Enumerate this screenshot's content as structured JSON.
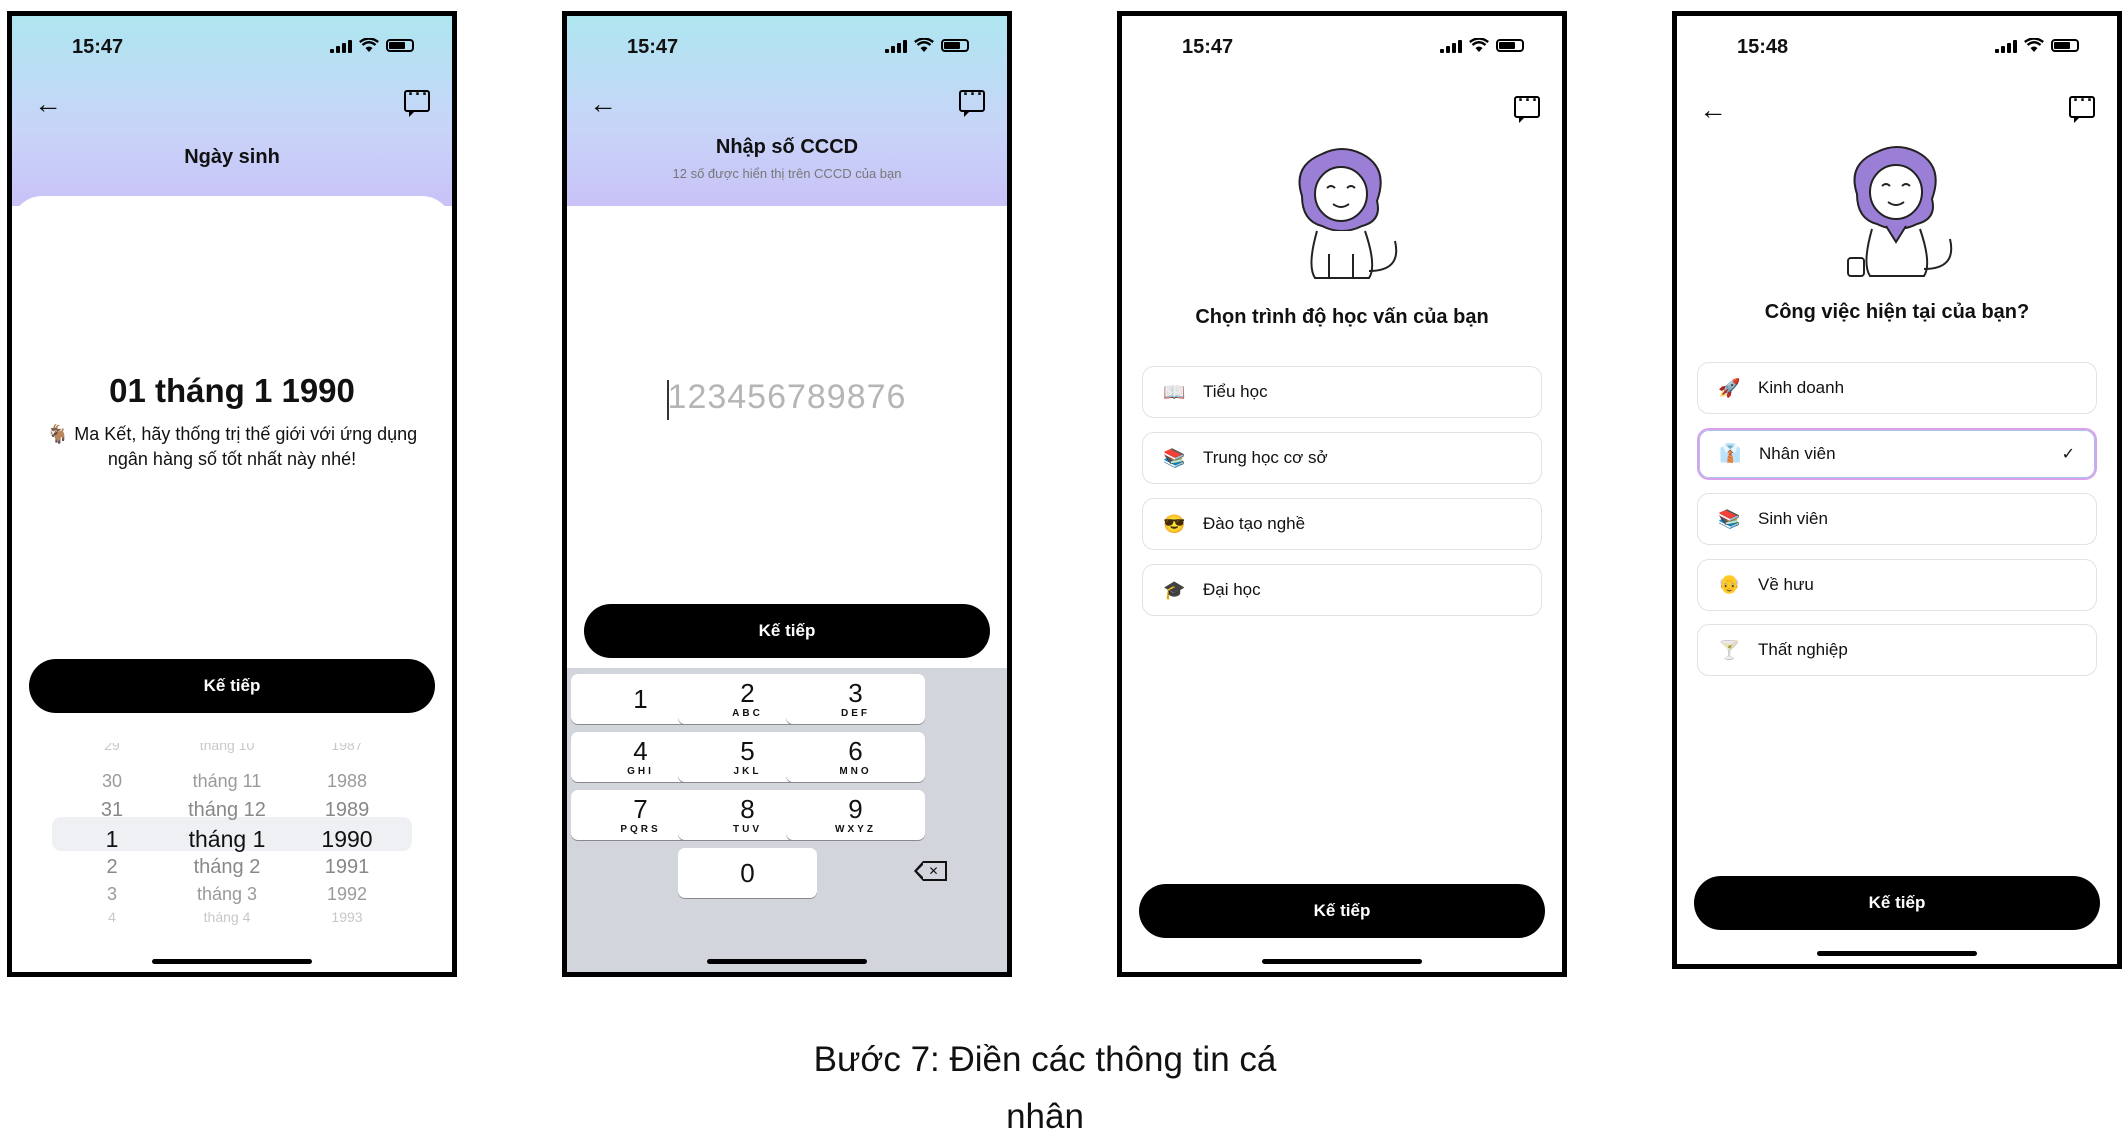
{
  "screens": {
    "dob": {
      "time": "15:47",
      "title": "Ngày sinh",
      "date_display": "01 tháng 1 1990",
      "zodiac_emoji": "🐐",
      "zodiac_line1": "Ma Kết, hãy thống trị thế giới với ứng dụng",
      "zodiac_line2": "ngân hàng số tốt nhất này nhé!",
      "next_label": "Kế tiếp",
      "picker_rows": [
        {
          "day": "29",
          "month": "tháng 10",
          "year": "1987"
        },
        {
          "day": "30",
          "month": "tháng 11",
          "year": "1988"
        },
        {
          "day": "31",
          "month": "tháng 12",
          "year": "1989"
        },
        {
          "day": "1",
          "month": "tháng 1",
          "year": "1990"
        },
        {
          "day": "2",
          "month": "tháng 2",
          "year": "1991"
        },
        {
          "day": "3",
          "month": "tháng 3",
          "year": "1992"
        },
        {
          "day": "4",
          "month": "tháng 4",
          "year": "1993"
        }
      ]
    },
    "cccd": {
      "time": "15:47",
      "title": "Nhập số CCCD",
      "subtitle": "12 số được hiển thị trên CCCD của bạn",
      "input_placeholder": "123456789876",
      "next_label": "Kế tiếp",
      "keys": [
        {
          "n": "1",
          "l": ""
        },
        {
          "n": "2",
          "l": "ABC"
        },
        {
          "n": "3",
          "l": "DEF"
        },
        {
          "n": "4",
          "l": "GHI"
        },
        {
          "n": "5",
          "l": "JKL"
        },
        {
          "n": "6",
          "l": "MNO"
        },
        {
          "n": "7",
          "l": "PQRS"
        },
        {
          "n": "8",
          "l": "TUV"
        },
        {
          "n": "9",
          "l": "WXYZ"
        },
        {
          "n": "0",
          "l": ""
        }
      ]
    },
    "education": {
      "time": "15:47",
      "question": "Chọn trình độ học vấn của bạn",
      "options": [
        {
          "emoji": "📖",
          "label": "Tiểu học"
        },
        {
          "emoji": "📚",
          "label": "Trung học cơ sở"
        },
        {
          "emoji": "😎",
          "label": "Đào tạo nghề"
        },
        {
          "emoji": "🎓",
          "label": "Đại học"
        }
      ],
      "next_label": "Kế tiếp"
    },
    "job": {
      "time": "15:48",
      "question": "Công việc hiện tại của bạn?",
      "options": [
        {
          "emoji": "🚀",
          "label": "Kinh doanh"
        },
        {
          "emoji": "👔",
          "label": "Nhân viên"
        },
        {
          "emoji": "📚",
          "label": "Sinh viên"
        },
        {
          "emoji": "👴",
          "label": "Về hưu"
        },
        {
          "emoji": "🍸",
          "label": "Thất nghiệp"
        }
      ],
      "selected": "Nhân viên",
      "check_mark": "✓",
      "next_label": "Kế tiếp"
    }
  },
  "caption_line1": "Bước 7: Điền các thông tin cá",
  "caption_line2": "nhân",
  "colors": {
    "accent_lion": "#9b7fd6",
    "button": "#000000",
    "gradient_top": "#aee6f0",
    "gradient_bottom": "#c9c2f7",
    "selected_border": "#d9a2e8"
  }
}
